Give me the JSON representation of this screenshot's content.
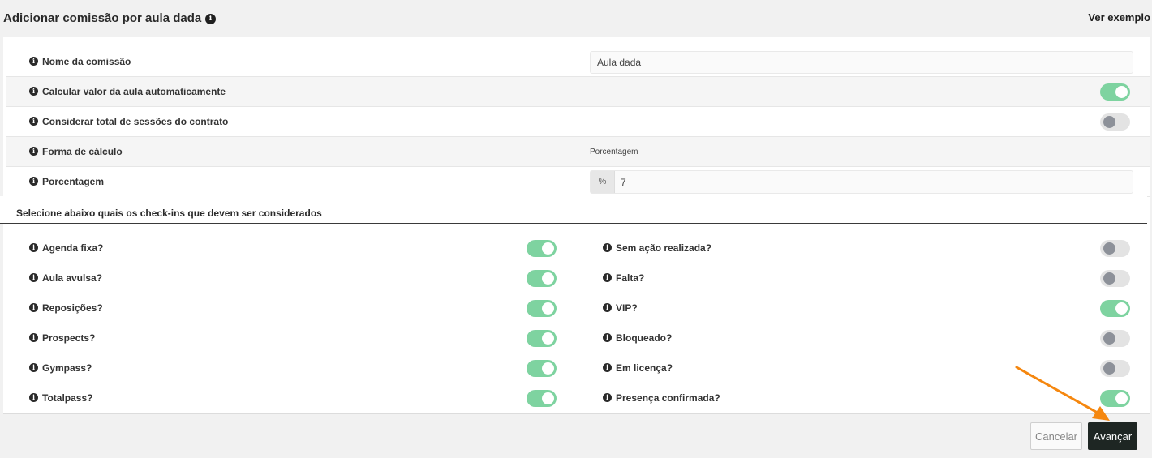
{
  "header": {
    "title": "Adicionar comissão por aula dada",
    "example_link": "Ver exemplo"
  },
  "settings": {
    "name_label": "Nome da comissão",
    "name_value": "Aula dada",
    "auto_calc_label": "Calcular valor da aula automaticamente",
    "auto_calc_on": true,
    "contract_sessions_label": "Considerar total de sessões do contrato",
    "contract_sessions_on": false,
    "calc_form_label": "Forma de cálculo",
    "calc_form_value": "Porcentagem",
    "percentage_label": "Porcentagem",
    "percentage_addon": "%",
    "percentage_value": "7"
  },
  "checkins": {
    "section_title": "Selecione abaixo quais os check-ins que devem ser considerados",
    "left": [
      {
        "label": "Agenda fixa?",
        "on": true
      },
      {
        "label": "Aula avulsa?",
        "on": true
      },
      {
        "label": "Reposições?",
        "on": true
      },
      {
        "label": "Prospects?",
        "on": true
      },
      {
        "label": "Gympass?",
        "on": true
      },
      {
        "label": "Totalpass?",
        "on": true
      }
    ],
    "right": [
      {
        "label": "Sem ação realizada?",
        "on": false
      },
      {
        "label": "Falta?",
        "on": false
      },
      {
        "label": "VIP?",
        "on": true
      },
      {
        "label": "Bloqueado?",
        "on": false
      },
      {
        "label": "Em licença?",
        "on": false
      },
      {
        "label": "Presença confirmada?",
        "on": true
      }
    ]
  },
  "footer": {
    "cancel_label": "Cancelar",
    "next_label": "Avançar"
  },
  "colors": {
    "toggle_on": "#7ed3a0",
    "toggle_off": "#e3e3e3",
    "primary_button": "#1e2623",
    "annotation_arrow": "#f5870f"
  }
}
